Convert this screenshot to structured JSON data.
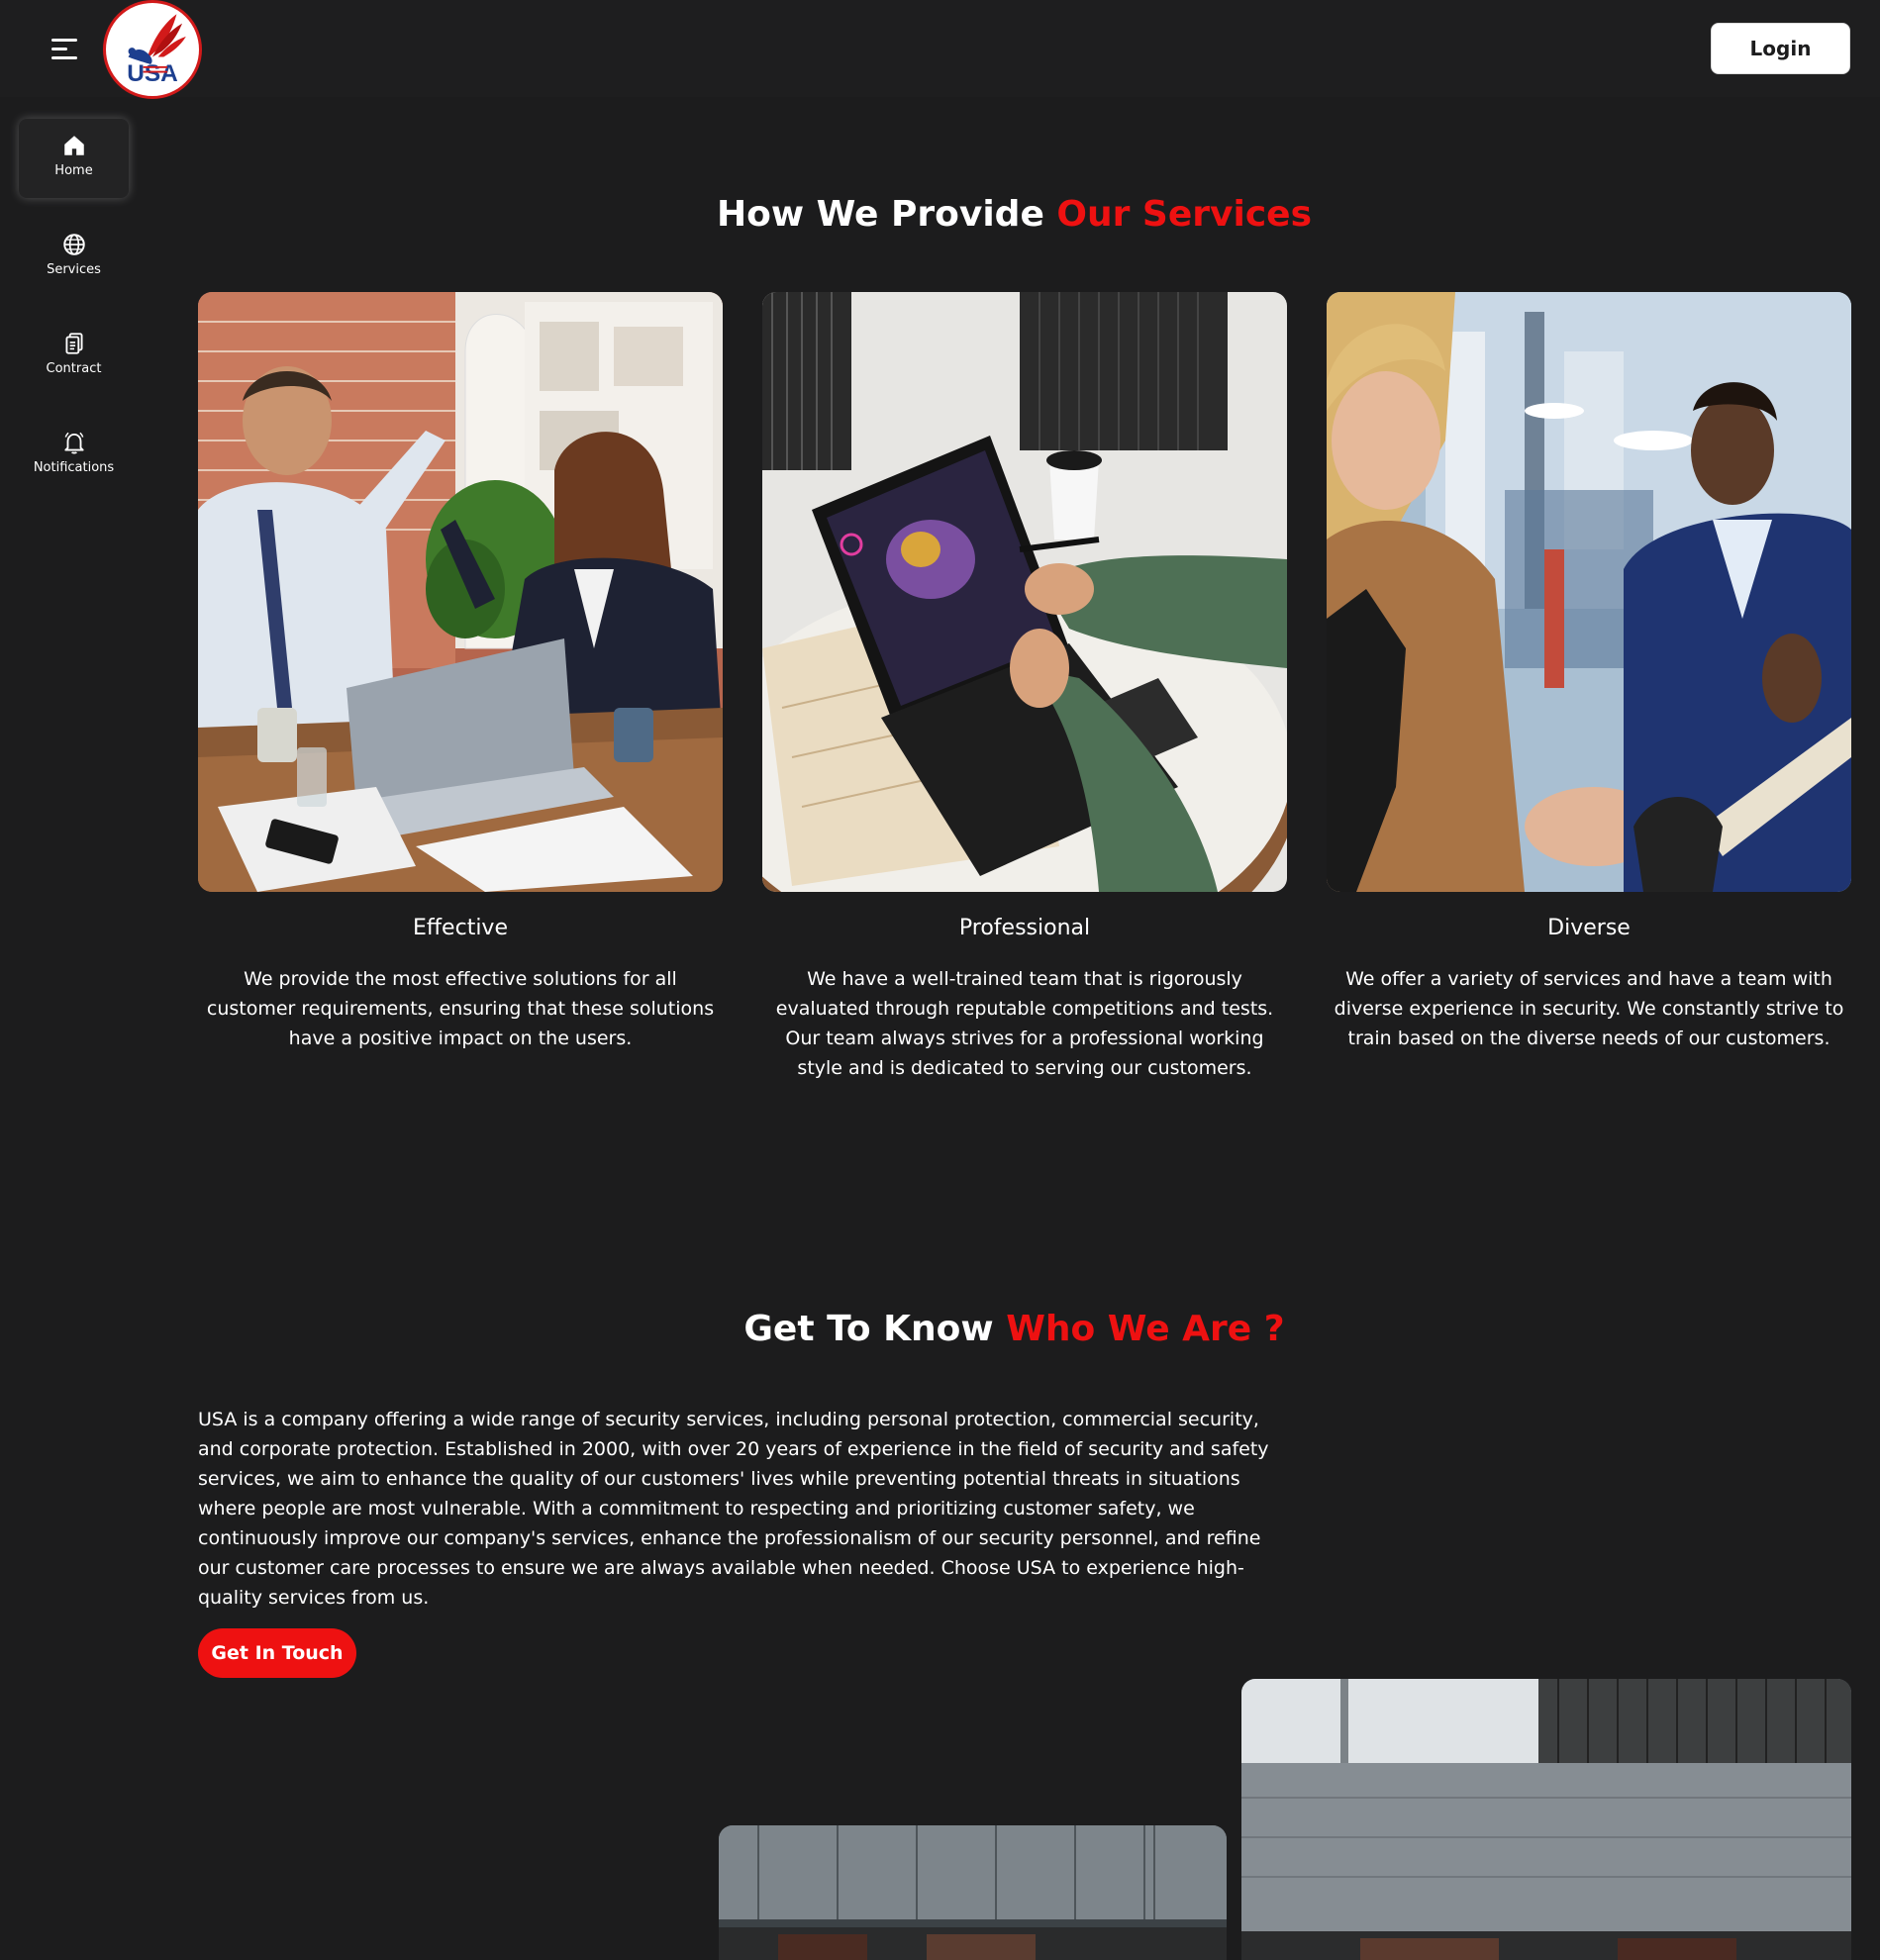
{
  "header": {
    "logo_text": "USA",
    "login_label": "Login"
  },
  "sidebar": {
    "items": [
      {
        "label": "Home",
        "icon": "home-icon",
        "active": true
      },
      {
        "label": "Services",
        "icon": "globe-icon",
        "active": false
      },
      {
        "label": "Contract",
        "icon": "document-icon",
        "active": false
      },
      {
        "label": "Notifications",
        "icon": "bell-icon",
        "active": false
      }
    ]
  },
  "services_section": {
    "title_white": "How We Provide",
    "title_red": "Our Services",
    "cards": [
      {
        "title": "Effective",
        "description": "We provide the most effective solutions for all customer requirements, ensuring that these solutions have a positive impact on the users."
      },
      {
        "title": "Professional",
        "description": "We have a well-trained team that is rigorously evaluated through reputable competitions and tests. Our team always strives for a professional working style and is dedicated to serving our customers."
      },
      {
        "title": "Diverse",
        "description": "We offer a variety of services and have a team with diverse experience in security. We constantly strive to train based on the diverse needs of our customers."
      }
    ]
  },
  "about_section": {
    "title_white": "Get To Know",
    "title_red": "Who We Are ?",
    "body": "USA is a company offering a wide range of security services, including personal protection, commercial security, and corporate protection. Established in 2000, with over 20 years of experience in the field of security and safety services, we aim to enhance the quality of our customers' lives while preventing potential threats in situations where people are most vulnerable. With a commitment to respecting and prioritizing customer safety, we continuously improve our company's services, enhance the professionalism of our security personnel, and refine our customer care processes to ensure we are always available when needed. Choose USA to experience high-quality services from us.",
    "cta_label": "Get In Touch"
  },
  "colors": {
    "background": "#1c1c1d",
    "accent_red": "#ee1111",
    "text": "#ffffff"
  }
}
